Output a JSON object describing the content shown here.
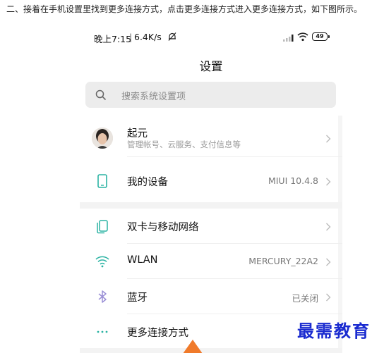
{
  "instruction": "二、接着在手机设置里找到更多连接方式，点击更多连接方式进入更多连接方式，如下图所示。",
  "status_bar": {
    "time": "晚上7:15",
    "separator": "|",
    "speed": "6.4K/s",
    "battery": "49"
  },
  "page": {
    "title": "设置"
  },
  "search": {
    "placeholder": "搜索系统设置项"
  },
  "account": {
    "name": "起元",
    "subtitle": "管理帐号、云服务、支付信息等"
  },
  "device": {
    "label": "我的设备",
    "value": "MIUI 10.4.8"
  },
  "network": [
    {
      "label": "双卡与移动网络",
      "value": ""
    },
    {
      "label": "WLAN",
      "value": "MERCURY_22A2"
    },
    {
      "label": "蓝牙",
      "value": "已关闭"
    },
    {
      "label": "更多连接方式",
      "value": ""
    }
  ],
  "watermark": "最需教育",
  "colors": {
    "accent_teal": "#2bb3a3",
    "bluetooth": "#9a8fd6",
    "pointer": "#f07a2a",
    "watermark": "#1a2bd0"
  }
}
